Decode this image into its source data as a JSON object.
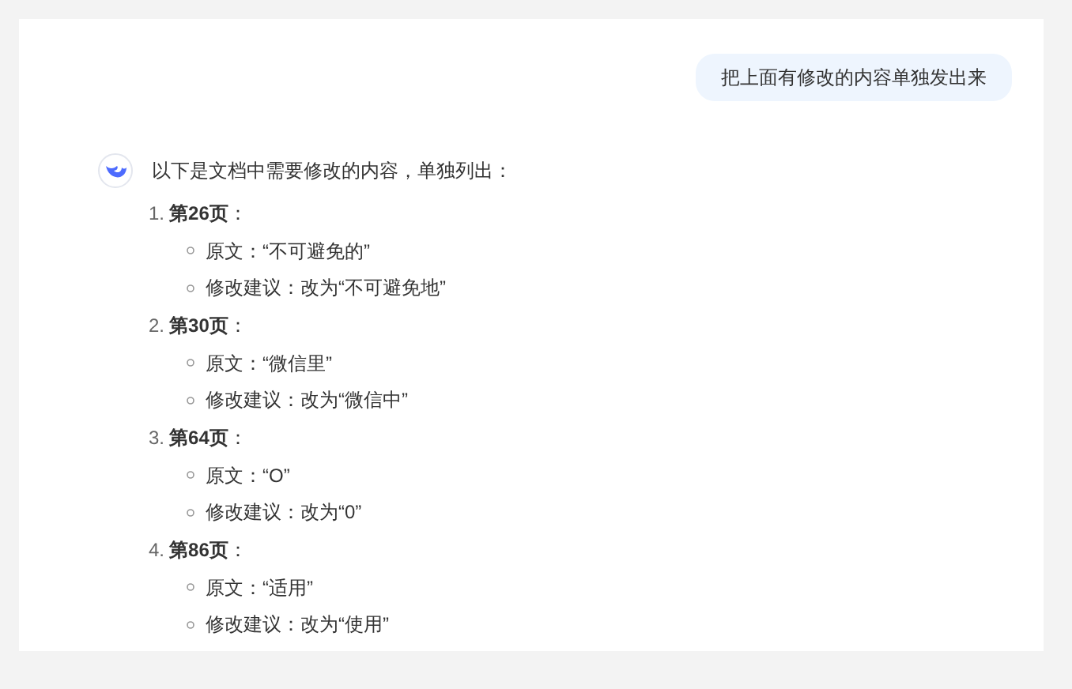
{
  "user_message": "把上面有修改的内容单独发出来",
  "reply": {
    "intro": "以下是文档中需要修改的内容，单独列出：",
    "items": [
      {
        "number": "1.",
        "title": "**第26页**：",
        "details": [
          "原文：“不可避免的”",
          "修改建议：改为“不可避免地”"
        ]
      },
      {
        "number": "2.",
        "title": "**第30页**：",
        "details": [
          "原文：“微信里”",
          "修改建议：改为“微信中”"
        ]
      },
      {
        "number": "3.",
        "title": "**第64页**：",
        "details": [
          "原文：“O”",
          "修改建议：改为“0”"
        ]
      },
      {
        "number": "4.",
        "title": "**第86页**：",
        "details": [
          "原文：“适用”",
          "修改建议：改为“使用”"
        ]
      }
    ]
  }
}
